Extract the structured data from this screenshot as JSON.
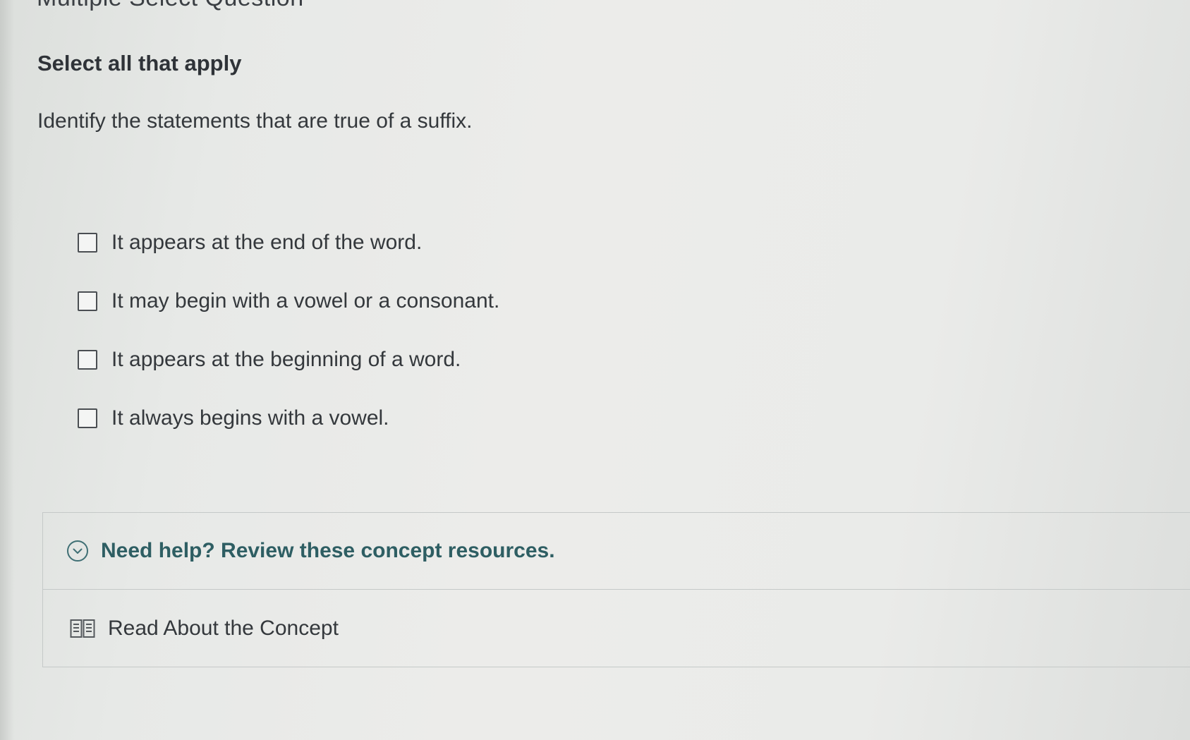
{
  "header": {
    "title": "Multiple Select Question"
  },
  "question": {
    "instruction": "Select all that apply",
    "prompt": "Identify the statements that are true of a suffix.",
    "options": [
      {
        "label": "It appears at the end of the word.",
        "checked": false
      },
      {
        "label": "It may begin with a vowel or a consonant.",
        "checked": false
      },
      {
        "label": "It appears at the beginning of a word.",
        "checked": false
      },
      {
        "label": "It always begins with a vowel.",
        "checked": false
      }
    ]
  },
  "help": {
    "title": "Need help? Review these concept resources.",
    "toggle_icon": "chevron-down-circle-icon",
    "resources": [
      {
        "label": "Read About the Concept",
        "icon": "book-icon"
      }
    ]
  },
  "colors": {
    "help_title": "#2e5e63",
    "text": "#34383c",
    "background": "#ebece9"
  }
}
